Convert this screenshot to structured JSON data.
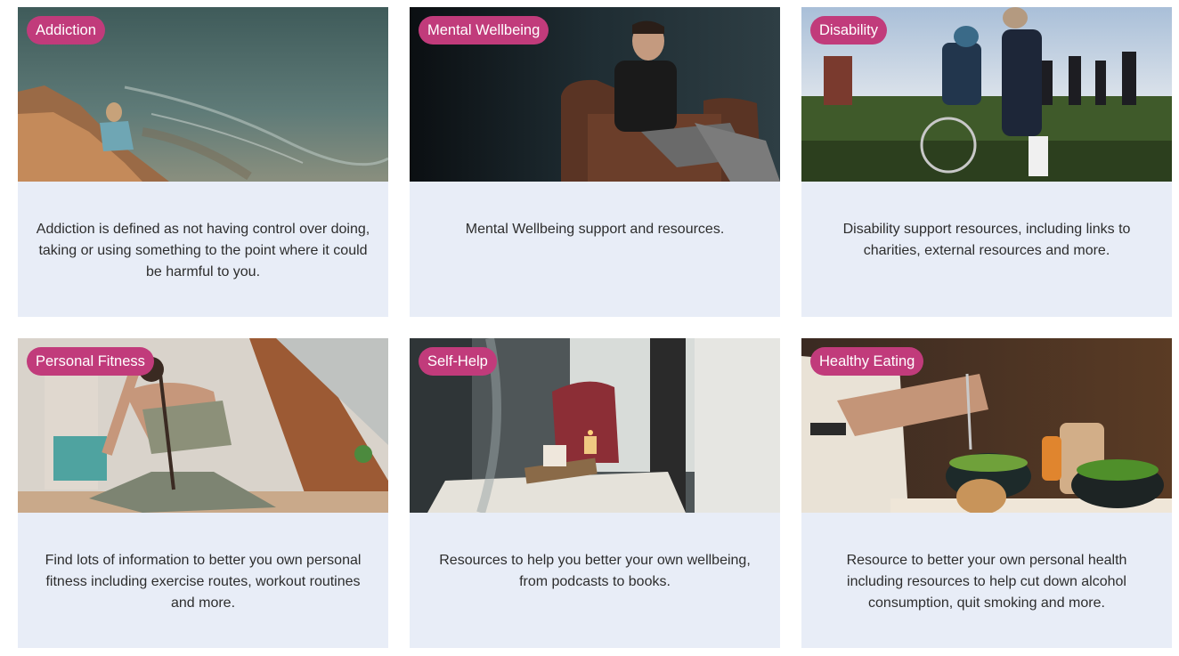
{
  "cards": [
    {
      "tag": "Addiction",
      "description": "Addiction is defined as not having control over doing, taking or using something to the point where it could be harmful to you.",
      "image": "woman-sitting-on-sea-cliff-photo"
    },
    {
      "tag": "Mental Wellbeing",
      "description": "Mental Wellbeing support and resources.",
      "image": "man-on-leather-armchair-photo"
    },
    {
      "tag": "Disability",
      "description": "Disability support resources, including links to charities, external resources and more.",
      "image": "wheelchair-user-in-field-photo"
    },
    {
      "tag": "Personal Fitness",
      "description": "Find lots of information to better you own personal fitness including exercise routes, workout routines and more.",
      "image": "woman-doing-yoga-photo"
    },
    {
      "tag": "Self-Help",
      "description": "Resources to help you better your own wellbeing, from podcasts to books.",
      "image": "cozy-window-seat-with-candle-photo"
    },
    {
      "tag": "Healthy Eating",
      "description": "Resource to better your own personal health including resources to help cut down alcohol consumption, quit smoking and more.",
      "image": "person-eating-salad-bowl-photo"
    }
  ],
  "colors": {
    "tag_background": "#c13b7b",
    "card_background": "#e8edf7",
    "text": "#2d2d2d"
  }
}
